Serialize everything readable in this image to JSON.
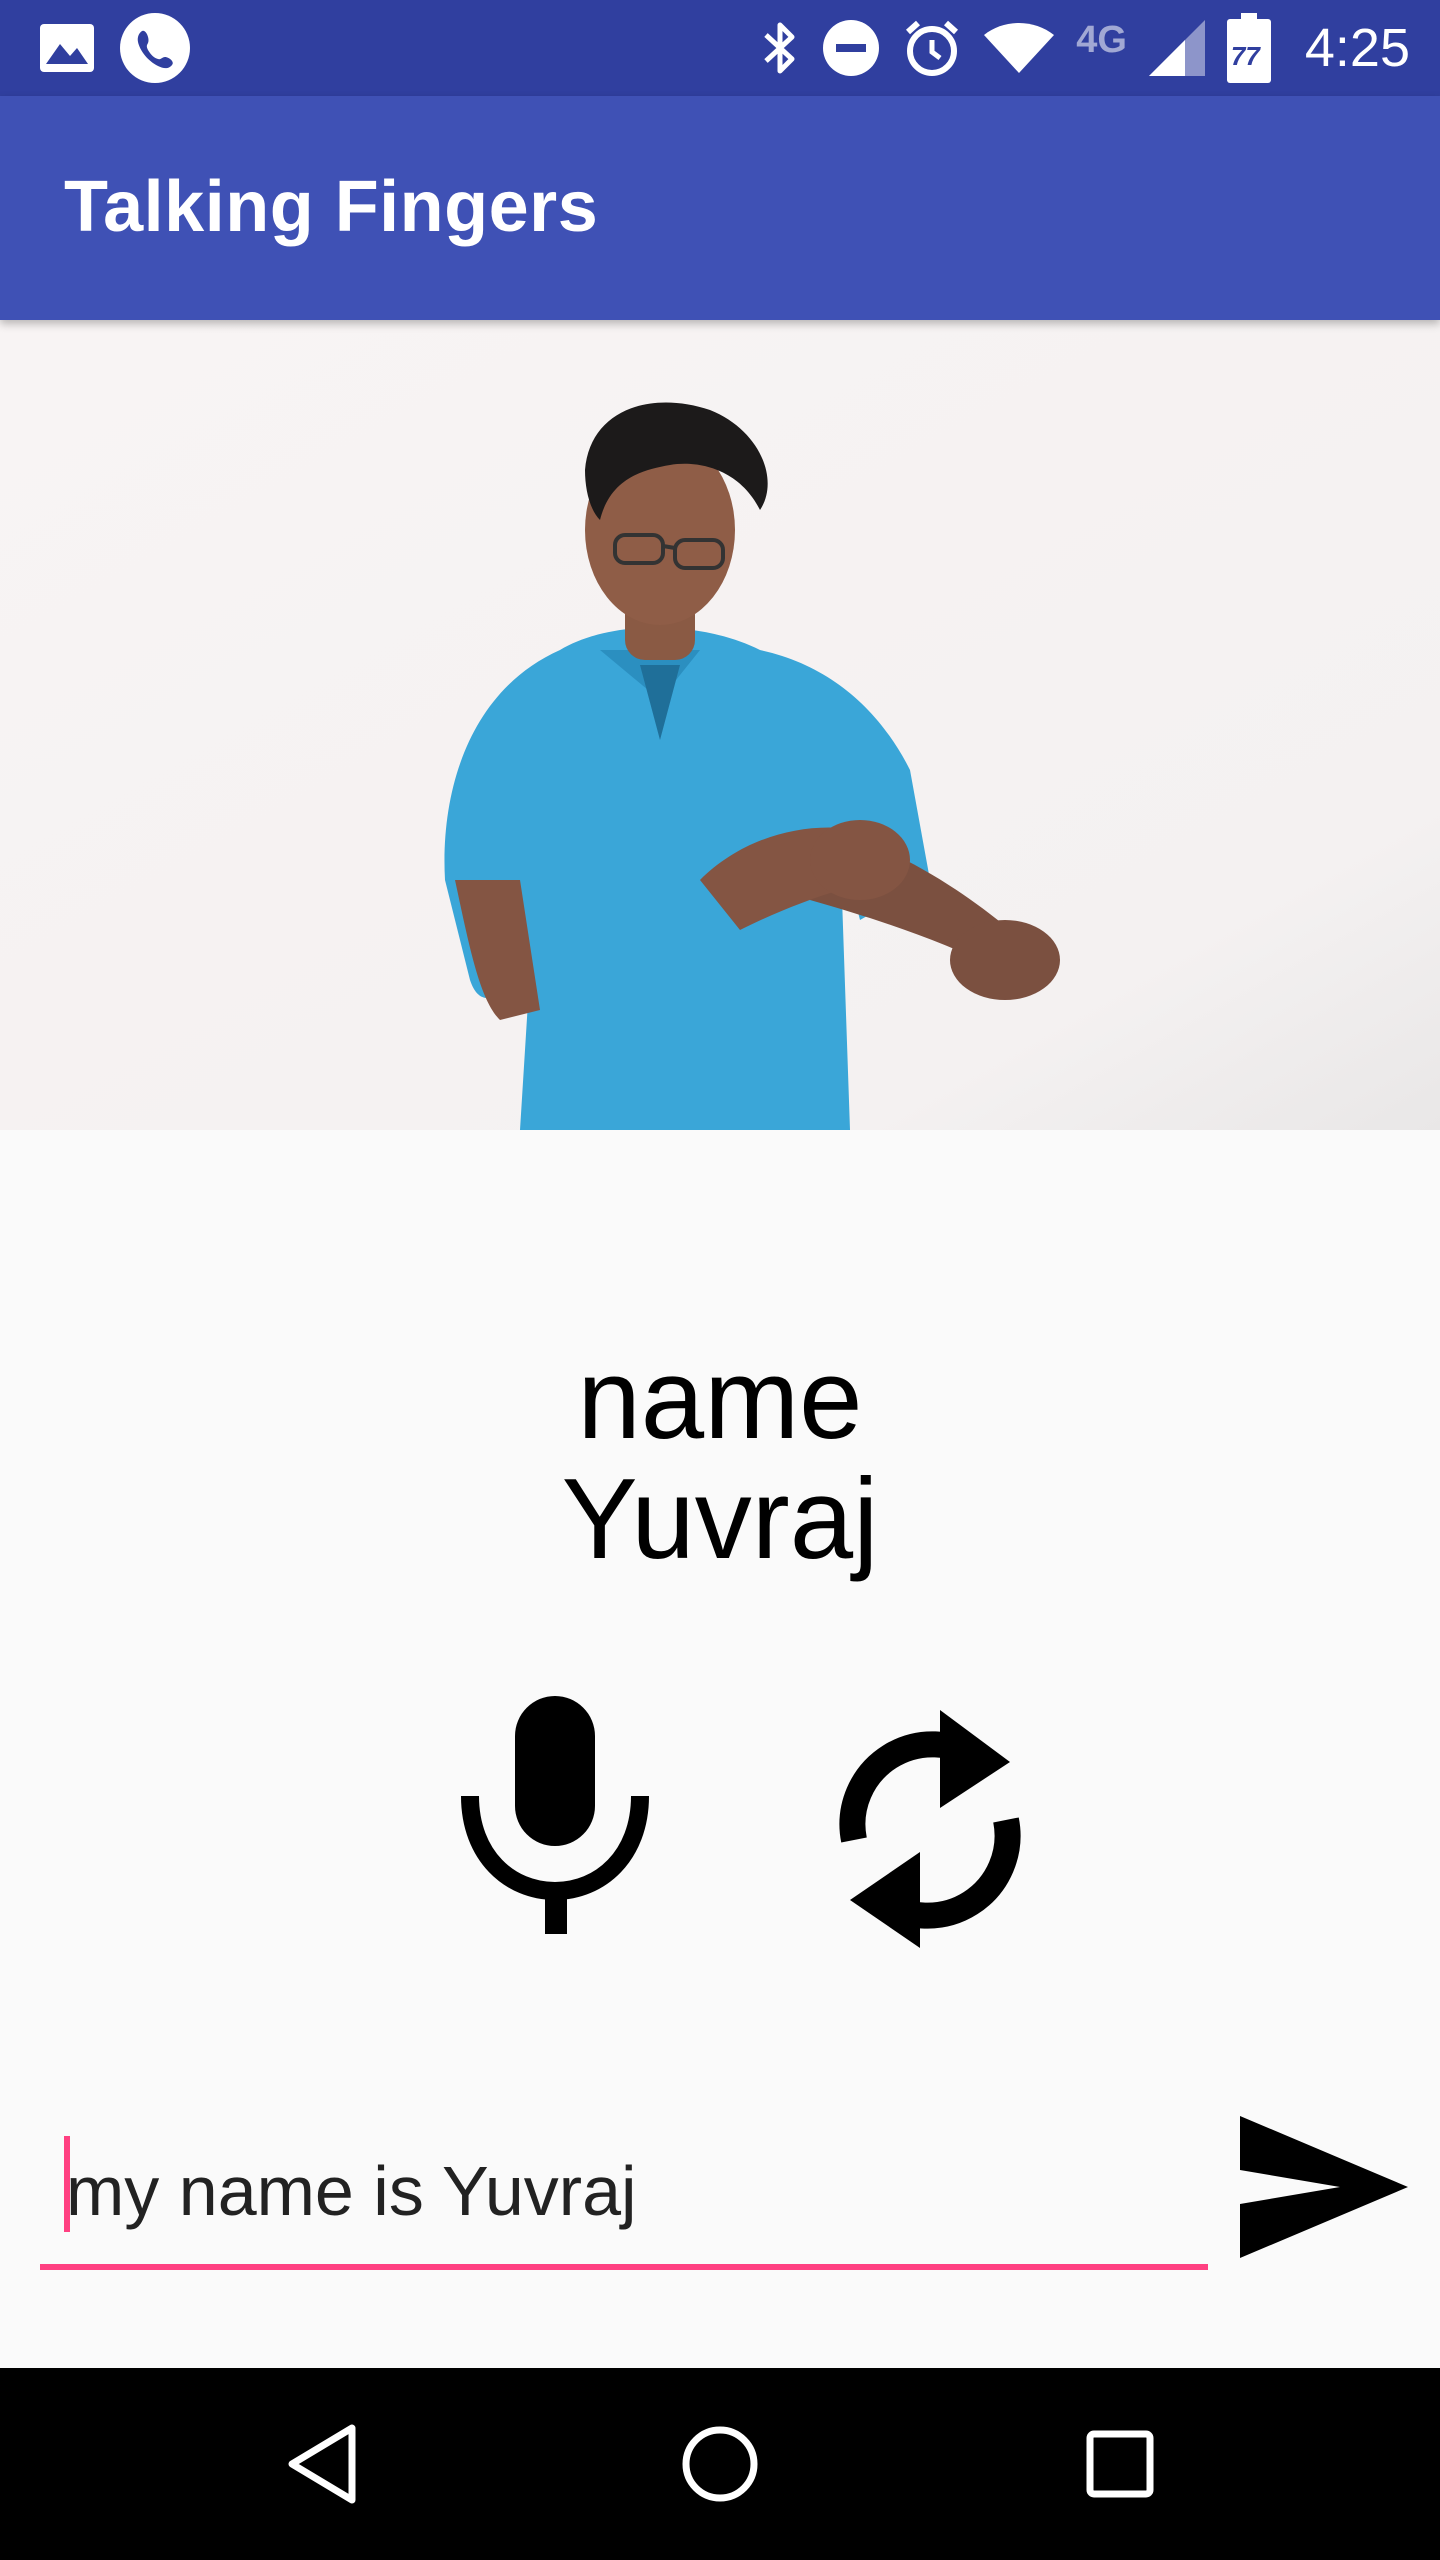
{
  "status_bar": {
    "network_label": "4G",
    "battery_level": "77",
    "time": "4:25",
    "icons": [
      "image-icon",
      "phone-icon",
      "bluetooth-icon",
      "do-not-disturb-icon",
      "alarm-icon",
      "wifi-icon",
      "cell-signal-icon",
      "battery-icon"
    ]
  },
  "app_bar": {
    "title": "Talking Fingers",
    "color": "#3f51b5"
  },
  "video": {
    "description_icon": "sign-language-video"
  },
  "recognized": {
    "line1": "name",
    "line2": "Yuvraj"
  },
  "actions": {
    "mic_icon": "mic-icon",
    "refresh_icon": "refresh-icon"
  },
  "input": {
    "value": "my name is Yuvraj",
    "accent": "#ff4081"
  },
  "send": {
    "icon": "send-icon"
  },
  "nav": {
    "icons": [
      "back-icon",
      "home-icon",
      "recents-icon"
    ]
  }
}
